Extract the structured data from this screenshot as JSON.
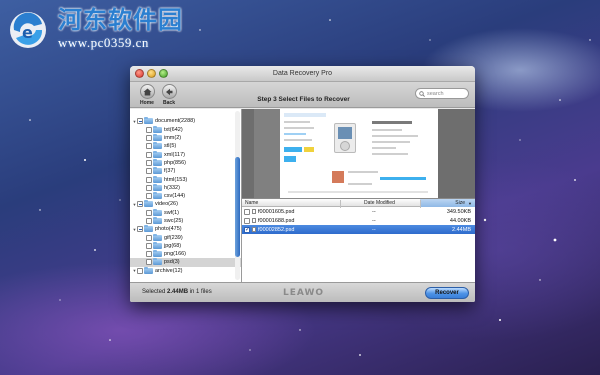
{
  "watermark": {
    "title": "河东软件园",
    "url": "www.pc0359.cn"
  },
  "window": {
    "title": "Data Recovery Pro",
    "toolbar": {
      "home_label": "Home",
      "back_label": "Back",
      "step_title": "Step 3 Select Files to Recover",
      "search_placeholder": "search"
    }
  },
  "tree": {
    "items": [
      {
        "label": "",
        "level": 0,
        "state": "none"
      },
      {
        "label": "document(2288)",
        "level": 0,
        "state": "partial"
      },
      {
        "label": "txt(642)",
        "level": 1
      },
      {
        "label": "imm(2)",
        "level": 1
      },
      {
        "label": "stl(5)",
        "level": 1
      },
      {
        "label": "xml(117)",
        "level": 1
      },
      {
        "label": "php(856)",
        "level": 1
      },
      {
        "label": "f(37)",
        "level": 1
      },
      {
        "label": "html(153)",
        "level": 1
      },
      {
        "label": "h(332)",
        "level": 1
      },
      {
        "label": "csv(144)",
        "level": 1
      },
      {
        "label": "video(26)",
        "level": 0,
        "state": "partial"
      },
      {
        "label": "swf(1)",
        "level": 1
      },
      {
        "label": "swc(25)",
        "level": 1
      },
      {
        "label": "photo(475)",
        "level": 0,
        "state": "partial"
      },
      {
        "label": "gif(239)",
        "level": 1
      },
      {
        "label": "jpg(68)",
        "level": 1
      },
      {
        "label": "png(166)",
        "level": 1
      },
      {
        "label": "psd(3)",
        "level": 1,
        "selected": true
      },
      {
        "label": "archive(12)",
        "level": 0
      }
    ]
  },
  "filelist": {
    "headers": {
      "name": "Name",
      "date": "Date Modified",
      "size": "Size"
    },
    "rows": [
      {
        "name": "f00001605.psd",
        "date": "--",
        "size": "349.50KB",
        "checked": false,
        "selected": false
      },
      {
        "name": "f00001688.psd",
        "date": "--",
        "size": "44.00KB",
        "checked": false,
        "selected": false
      },
      {
        "name": "f00002852.psd",
        "date": "--",
        "size": "2.44MB",
        "checked": true,
        "selected": true
      }
    ]
  },
  "bottom": {
    "status_prefix": "Selected",
    "status_size": "2.44MB",
    "status_suffix": "in 1 files",
    "brand": "LEAWO",
    "recover_label": "Recover"
  }
}
